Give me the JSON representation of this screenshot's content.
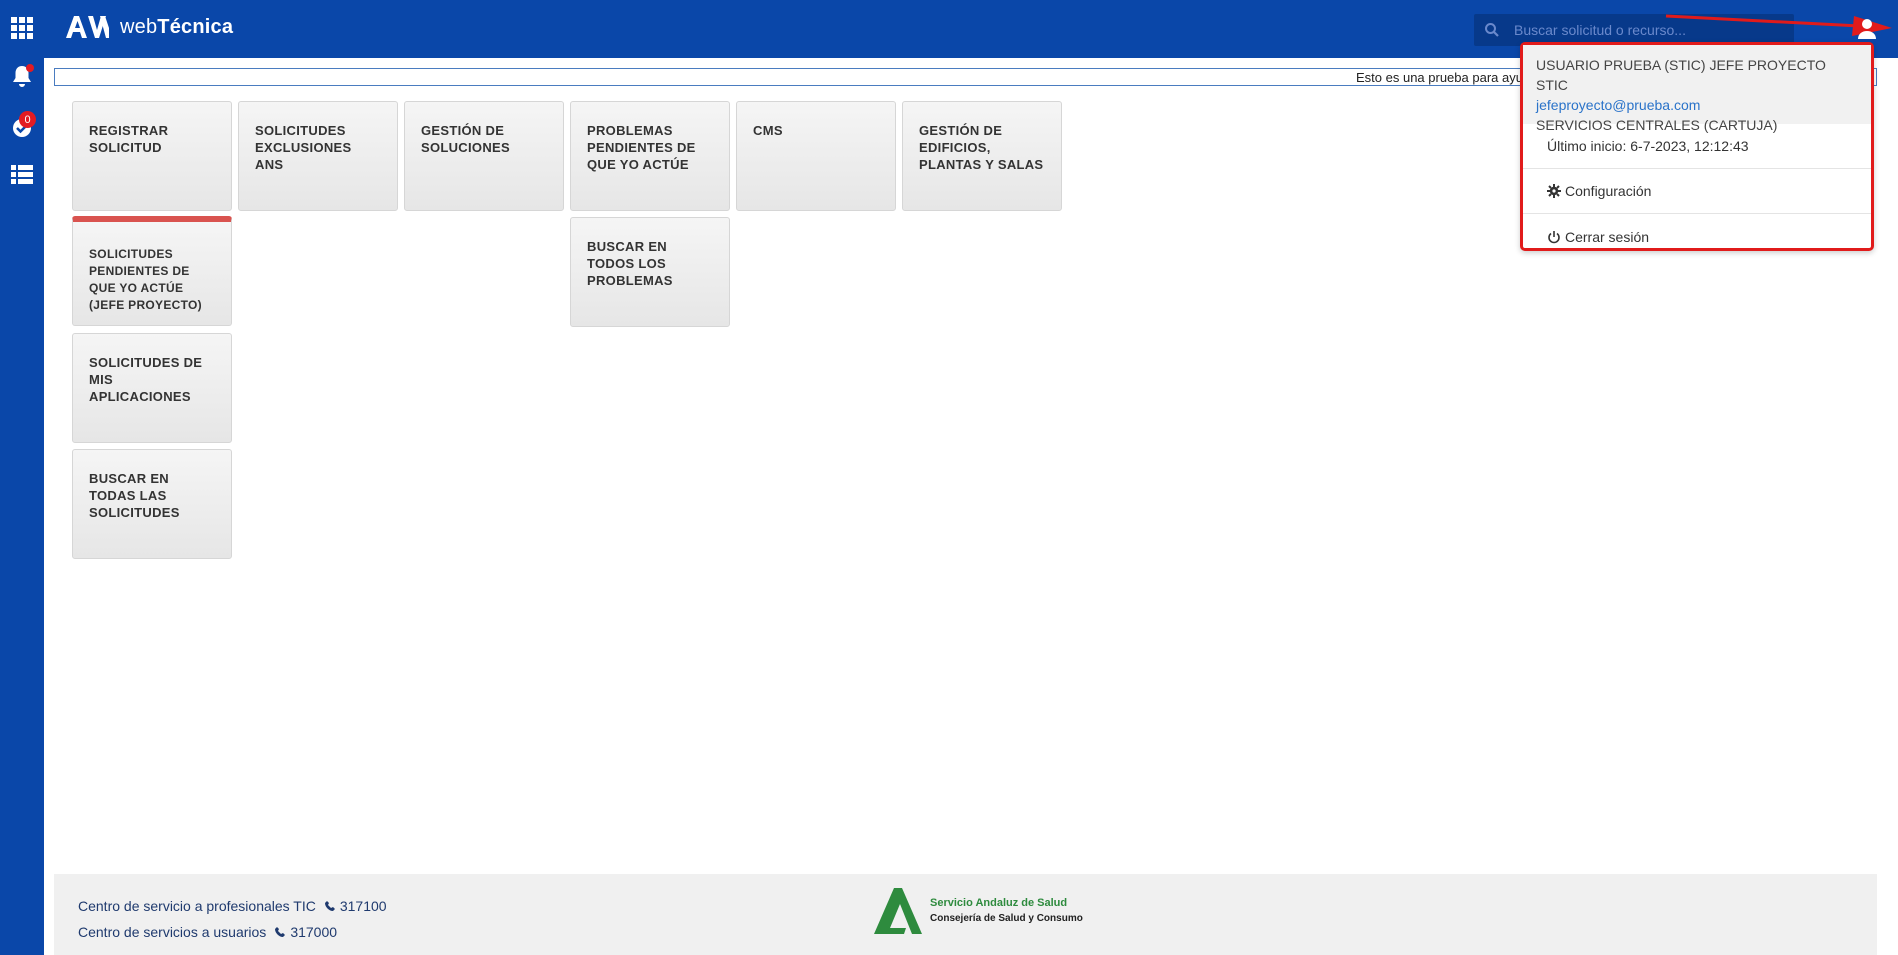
{
  "app": {
    "brand_prefix": "web",
    "brand_suffix": "Técnica"
  },
  "rail": {
    "badge_count": "0"
  },
  "search": {
    "placeholder": "Buscar solicitud o recurso..."
  },
  "notice": {
    "text": "Esto es una prueba para ayuda"
  },
  "tiles": [
    {
      "label": "REGISTRAR SOLICITUD"
    },
    {
      "label": "SOLICITUDES EXCLUSIONES ANS"
    },
    {
      "label": "GESTIÓN DE SOLUCIONES"
    },
    {
      "label": "PROBLEMAS PENDIENTES DE QUE YO ACTÚE"
    },
    {
      "label": "CMS"
    },
    {
      "label": "GESTIÓN DE EDIFICIOS, PLANTAS Y SALAS"
    },
    {
      "label": "SOLICITUDES PENDIENTES DE QUE YO ACTÚE (JEFE PROYECTO)"
    },
    {
      "label": "BUSCAR EN TODOS LOS PROBLEMAS"
    },
    {
      "label": "SOLICITUDES DE MIS APLICACIONES"
    },
    {
      "label": "BUSCAR EN TODAS LAS SOLICITUDES"
    }
  ],
  "user_menu": {
    "name": "USUARIO PRUEBA (STIC) JEFE PROYECTO STIC",
    "email": "jefeproyecto@prueba.com",
    "unit": "SERVICIOS CENTRALES (CARTUJA)",
    "last_login": "Último inicio: 6-7-2023, 12:12:43",
    "settings_label": "Configuración",
    "logout_label": "Cerrar sesión"
  },
  "footer": {
    "line1": "Centro de servicio a profesionales TIC",
    "phone1": "317100",
    "line2": "Centro de servicios a usuarios",
    "phone2": "317000",
    "logo_line1": "Servicio Andaluz de Salud",
    "logo_line2": "Consejería de Salud y Consumo"
  },
  "colors": {
    "primary": "#0a47a9",
    "highlight": "#e11b1b",
    "tile_alert": "#d9534f"
  }
}
